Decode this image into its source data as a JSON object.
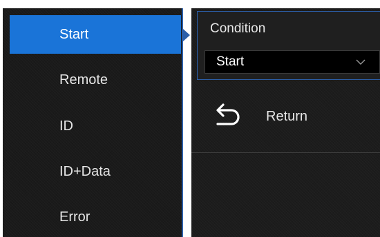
{
  "trigger_types": {
    "items": [
      {
        "label": "Start",
        "selected": true
      },
      {
        "label": "Remote",
        "selected": false
      },
      {
        "label": "ID",
        "selected": false
      },
      {
        "label": "ID+Data",
        "selected": false
      },
      {
        "label": "Error",
        "selected": false
      }
    ]
  },
  "condition": {
    "title": "Condition",
    "value": "Start",
    "icon": "chevron-down-icon"
  },
  "return_key": {
    "label": "Return",
    "icon": "return-arrow-icon"
  },
  "colors": {
    "accent": "#1a74d8",
    "border": "#2b5ea8",
    "panel_bg": "#1c1c1c",
    "text": "#e8e8e8"
  }
}
